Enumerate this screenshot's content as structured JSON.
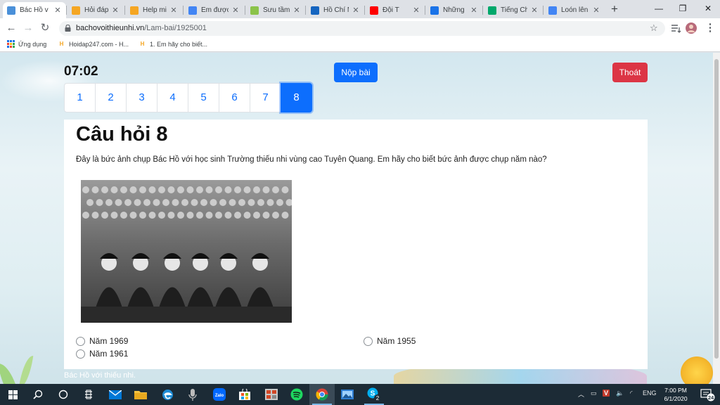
{
  "browser": {
    "tabs": [
      {
        "title": "Bác Hồ v",
        "favicon": "doc-icon",
        "color": "#4a90d9",
        "active": true
      },
      {
        "title": "Hỏi đáp",
        "favicon": "hoidap-icon",
        "color": "#f5a623"
      },
      {
        "title": "Help min",
        "favicon": "hoidap-icon",
        "color": "#f5a623"
      },
      {
        "title": "Em được",
        "favicon": "google-icon",
        "color": "#4285f4"
      },
      {
        "title": "Sưu tầm",
        "favicon": "sticker-icon",
        "color": "#8bc34a"
      },
      {
        "title": "Hồ Chí M",
        "favicon": "tv-icon",
        "color": "#1565c0"
      },
      {
        "title": "Đội T",
        "favicon": "youtube-icon",
        "color": "#ff0000"
      },
      {
        "title": "Những b",
        "favicon": "globe-icon",
        "color": "#1a73e8"
      },
      {
        "title": "Tiếng Ch",
        "favicon": "flag-icon",
        "color": "#00a86b"
      },
      {
        "title": "Loón lên",
        "favicon": "google-icon",
        "color": "#4285f4"
      }
    ],
    "new_tab_symbol": "+",
    "window_controls": {
      "minimize": "—",
      "maximize": "❐",
      "close": "✕"
    },
    "url_domain": "bachovoithieunhi.vn",
    "url_path": "/Lam-bai/1925001",
    "bookmarks": [
      {
        "label": "Ứng dụng",
        "icon": "apps-grid-icon"
      },
      {
        "label": "Hoidap247.com - H...",
        "icon": "hoidap-icon"
      },
      {
        "label": "1. Em hãy cho biết...",
        "icon": "hoidap-icon"
      }
    ]
  },
  "quiz": {
    "timer": "07:02",
    "submit_label": "Nộp bài",
    "exit_label": "Thoát",
    "pages": [
      "1",
      "2",
      "3",
      "4",
      "5",
      "6",
      "7",
      "8"
    ],
    "current_page": "8",
    "question_title": "Câu hỏi 8",
    "question_text": "Đây là bức ảnh chụp Bác Hồ với học sinh Trường thiếu nhi vùng cao Tuyên Quang. Em hãy cho biết bức ảnh được chụp năm nào?",
    "options": [
      "Năm 1969",
      "Năm 1955",
      "Năm 1961"
    ],
    "footer": "Bác Hồ với thiếu nhi."
  },
  "taskbar": {
    "apps": [
      "windows-start-icon",
      "search-icon",
      "task-view-icon",
      "task-list-icon",
      "mail-icon",
      "file-explorer-icon",
      "edge-icon",
      "mic-app-icon",
      "zalo-icon",
      "store-icon",
      "slides-icon",
      "spotify-icon",
      "chrome-icon",
      "photo-app-icon",
      "skype-icon"
    ],
    "skype_badge": "2",
    "language": "ENG",
    "time": "7:00 PM",
    "date": "6/1/2020",
    "notification_count": "24"
  },
  "colors": {
    "primary": "#0d6efd",
    "danger": "#dc3545",
    "taskbar": "#1c2b36"
  }
}
